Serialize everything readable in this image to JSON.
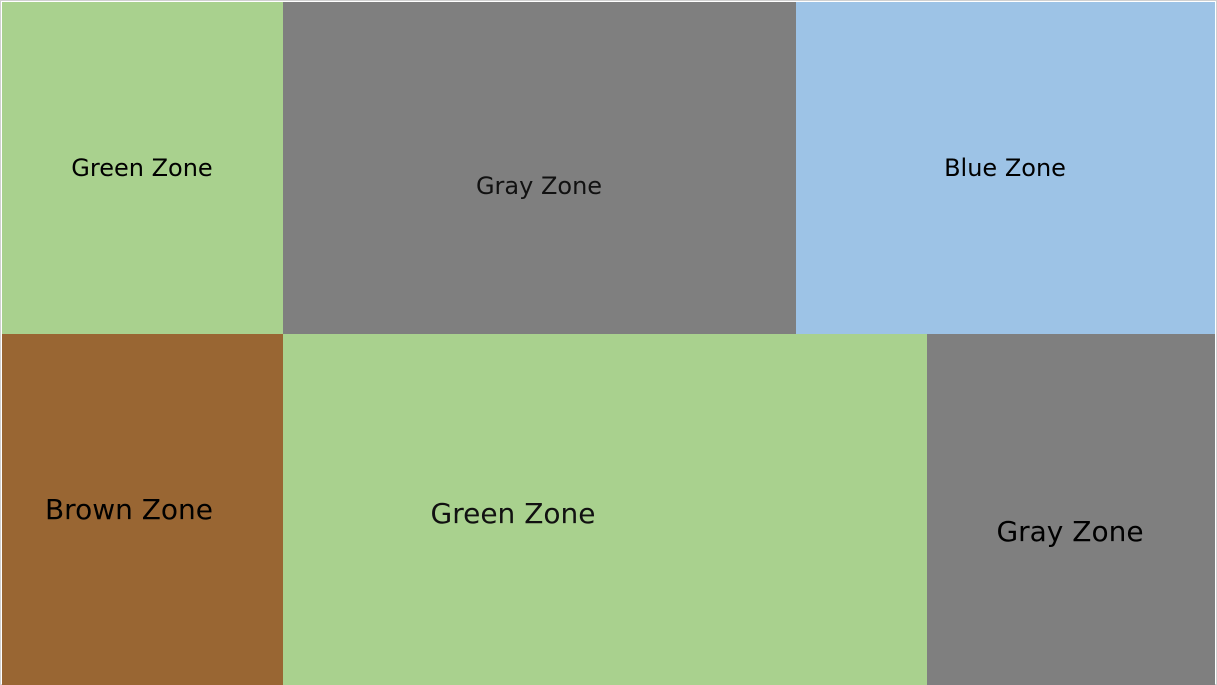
{
  "zones": [
    {
      "label": "Green Zone",
      "color": "#a9d18e"
    },
    {
      "label": "Gray Zone",
      "color": "#7f7f7f"
    },
    {
      "label": "Blue Zone",
      "color": "#9dc3e6"
    },
    {
      "label": "Brown Zone",
      "color": "#996633"
    },
    {
      "label": "Green Zone",
      "color": "#a9d18e"
    },
    {
      "label": "Gray Zone",
      "color": "#7f7f7f"
    }
  ]
}
